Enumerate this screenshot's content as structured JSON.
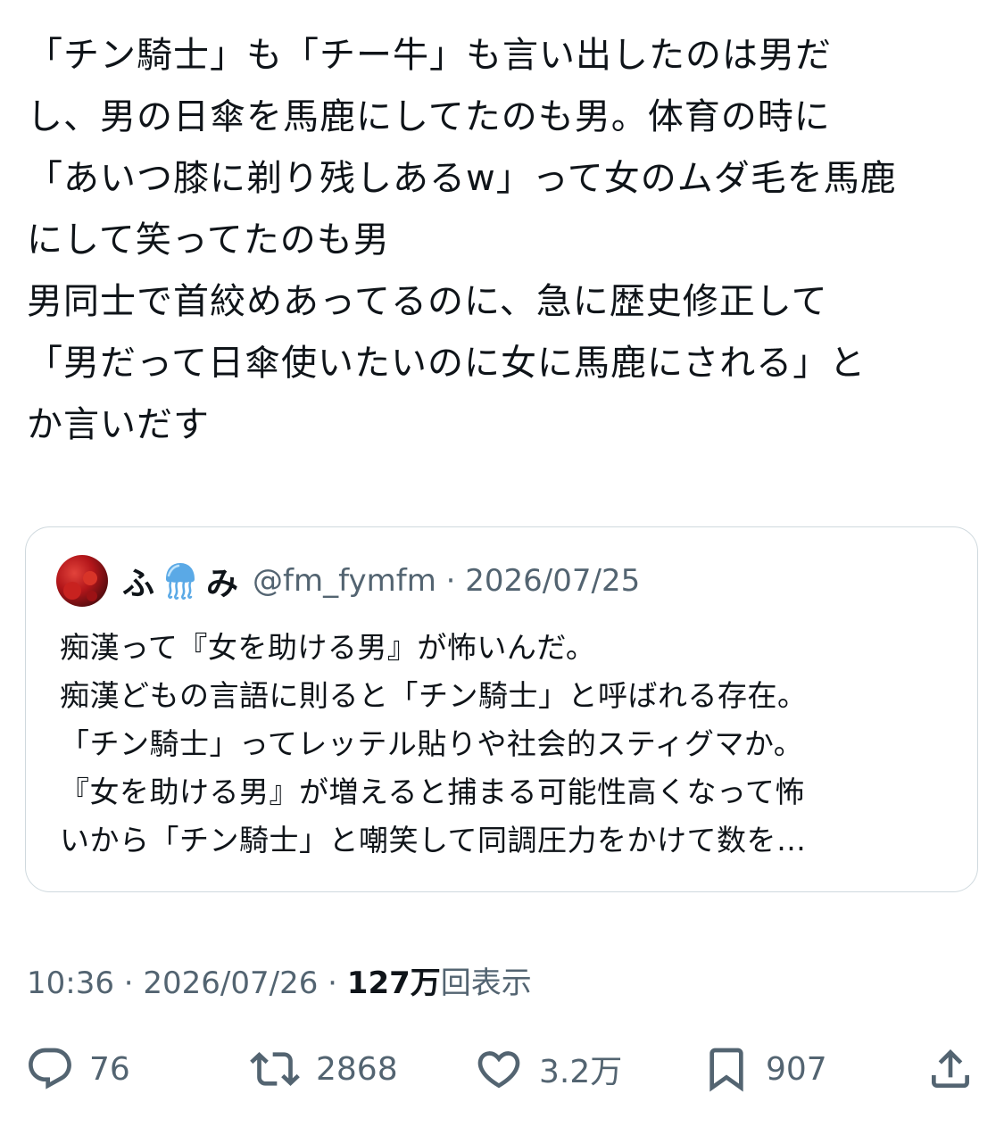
{
  "tweet": {
    "lines": [
      "「チン騎士」も「チー牛」も言い出したのは男だ",
      "し、男の日傘を馬鹿にしてたのも男。体育の時に",
      "「あいつ膝に剃り残しあるw」って女のムダ毛を馬鹿",
      "にして笑ってたのも男",
      "男同士で首絞めあってるのに、急に歴史修正して",
      "「男だって日傘使いたいのに女に馬鹿にされる」と",
      "か言いだす"
    ]
  },
  "quote": {
    "name_part1": "ふ",
    "name_emoji": "jellyfish-icon",
    "name_part2": "み",
    "handle_meta": "@fm_fymfm · 2026/07/25",
    "lines": [
      "痴漢って『女を助ける男』が怖いんだ。",
      "痴漢どもの言語に則ると「チン騎士」と呼ばれる存在。",
      "「チン騎士」ってレッテル貼りや社会的スティグマか。",
      "『女を助ける男』が増えると捕まる可能性高くなって怖",
      "いから「チン騎士」と嘲笑して同調圧力をかけて数を…"
    ]
  },
  "meta": {
    "time_date": "10:36 · 2026/07/26 · ",
    "views_count": "127万",
    "views_label": "回表示"
  },
  "actions": {
    "replies": "76",
    "retweets": "2868",
    "likes": "3.2万",
    "bookmarks": "907"
  },
  "colors": {
    "text": "#0f1419",
    "secondary": "#536471",
    "border": "#cfd9de",
    "jellyfish": "#5aa9e6"
  }
}
